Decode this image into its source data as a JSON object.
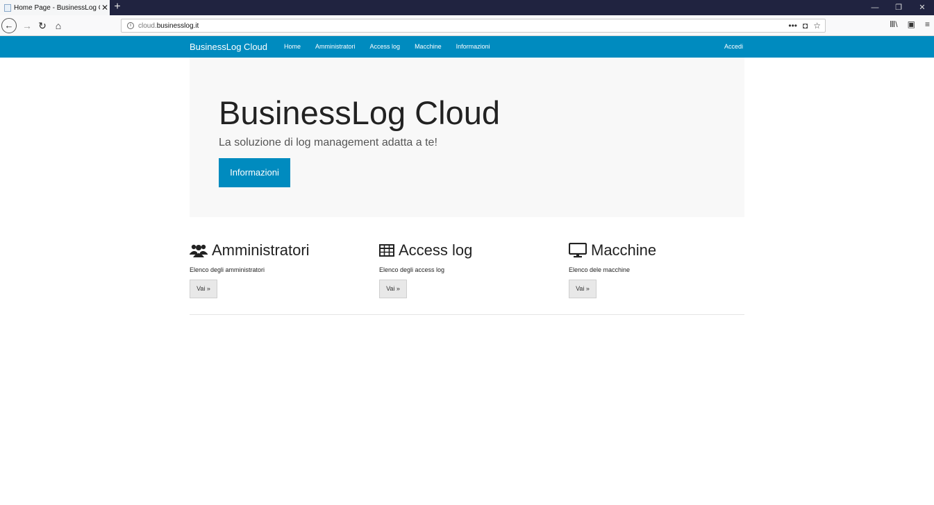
{
  "browser": {
    "tab_title": "Home Page - BusinessLog Cloud",
    "tab_close": "✕",
    "new_tab": "+",
    "url_prefix": "cloud.",
    "url_main": "businesslog.it",
    "url_actions": [
      "•••",
      "◘",
      "☆"
    ],
    "window_controls": [
      "—",
      "❐",
      "✕"
    ],
    "right_tools": [
      "Ⅲ\\",
      "▣",
      "≡"
    ]
  },
  "site": {
    "brand": "BusinessLog Cloud",
    "menu": [
      "Home",
      "Amministratori",
      "Access log",
      "Macchine",
      "Informazioni"
    ],
    "login": "Accedi"
  },
  "hero": {
    "title": "BusinessLog Cloud",
    "subtitle": "La soluzione di log management adatta a te!",
    "button": "Informazioni"
  },
  "sections": [
    {
      "icon": "users-icon",
      "title": "Amministratori",
      "description": "Elenco degli amministratori",
      "button": "Vai »"
    },
    {
      "icon": "table-icon",
      "title": "Access log",
      "description": "Elenco degli access log",
      "button": "Vai »"
    },
    {
      "icon": "monitor-icon",
      "title": "Macchine",
      "description": "Elenco dele macchine",
      "button": "Vai »"
    }
  ],
  "colors": {
    "primary": "#008bbf",
    "jumbotron_bg": "#f8f8f8",
    "tabbar_bg": "#202340"
  }
}
